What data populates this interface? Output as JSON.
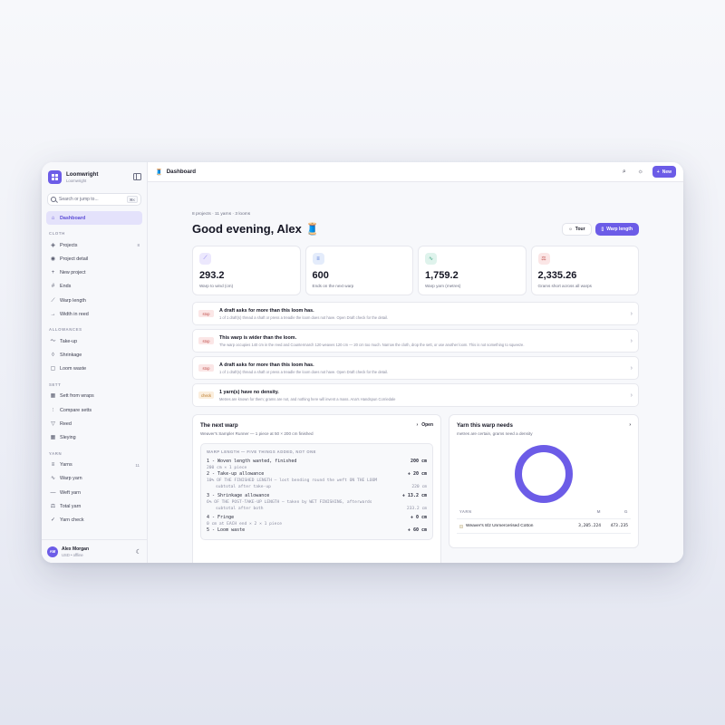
{
  "colors": {
    "accent": "#6c5ce7",
    "sidebar_bg": "#f7f8fb",
    "stop": "#c0504d",
    "check": "#b7731e"
  },
  "brand": {
    "name": "Loomwright",
    "sub": "Loomwright"
  },
  "search": {
    "placeholder": "Search or jump to...",
    "shortcut": "⌘K"
  },
  "nav": {
    "dashboard": "Dashboard",
    "sections": {
      "cloth": "CLOTH",
      "allowances": "ALLOWANCES",
      "sett": "SETT",
      "yarn": "YARN"
    },
    "cloth": [
      {
        "label": "Projects",
        "count": "8",
        "icon": "layers-icon"
      },
      {
        "label": "Project detail",
        "icon": "eye-icon"
      },
      {
        "label": "New project",
        "icon": "plus-icon"
      },
      {
        "label": "Ends",
        "icon": "hash-icon"
      },
      {
        "label": "Warp length",
        "icon": "ruler-icon"
      },
      {
        "label": "Width in reed",
        "icon": "arrow-right-icon"
      }
    ],
    "allowances": [
      {
        "label": "Take-up",
        "icon": "trend-icon"
      },
      {
        "label": "Shrinkage",
        "icon": "drop-icon"
      },
      {
        "label": "Loom waste",
        "icon": "trash-icon"
      }
    ],
    "sett": [
      {
        "label": "Sett from wraps",
        "icon": "grid-icon"
      },
      {
        "label": "Compare setts",
        "icon": "sliders-icon"
      },
      {
        "label": "Reed",
        "icon": "filter-icon"
      },
      {
        "label": "Sleying",
        "icon": "grid-icon"
      }
    ],
    "yarn": [
      {
        "label": "Yarns",
        "count": "11",
        "icon": "list-icon"
      },
      {
        "label": "Warp yarn",
        "icon": "pulse-icon"
      },
      {
        "label": "Weft yarn",
        "icon": "minus-icon"
      },
      {
        "label": "Total yarn",
        "icon": "scale-icon"
      },
      {
        "label": "Yarn check",
        "icon": "check-icon"
      }
    ]
  },
  "user": {
    "initials": "AM",
    "name": "Alex Morgan",
    "sub": "USD • offline"
  },
  "topbar": {
    "title": "Dashboard",
    "new_label": "New"
  },
  "meta": "8 projects · 11 yarns · 3 looms",
  "greeting": "Good evening, Alex 🧵",
  "buttons": {
    "tour": "Tour",
    "warp_length": "Warp length"
  },
  "stats": [
    {
      "value": "293.2",
      "label": "Warp to wind (cm)",
      "icon": "ruler-icon",
      "color": "#ece8fd",
      "fg": "#6c5ce7"
    },
    {
      "value": "600",
      "label": "Ends on the next warp",
      "icon": "list-icon",
      "color": "#e4ecfb",
      "fg": "#4a6fd6"
    },
    {
      "value": "1,759.2",
      "label": "Warp yarn (metres)",
      "icon": "pulse-icon",
      "color": "#dff3ec",
      "fg": "#2f9d76"
    },
    {
      "value": "2,335.26",
      "label": "Grams short across all warps",
      "icon": "scale-icon",
      "color": "#fbe6e6",
      "fg": "#c0504d"
    }
  ],
  "alerts": [
    {
      "badge": "stop",
      "title": "A draft asks for more than this loom has.",
      "desc": "1 of 1 draft(s) thread a shaft or press a treadle the loom does not have. Open Draft check for the detail."
    },
    {
      "badge": "stop",
      "title": "This warp is wider than the loom.",
      "desc": "The warp occupies 140 cm in the reed and Countermarch 120 weaves 120 cm — 20 cm too much. Narrow the cloth, drop the sett, or use another loom. This is not something to squeeze."
    },
    {
      "badge": "stop",
      "title": "A draft asks for more than this loom has.",
      "desc": "1 of 1 draft(s) thread a shaft or press a treadle the loom does not have. Open Draft check for the detail."
    },
    {
      "badge": "check",
      "title": "1 yarn(s) have no density.",
      "desc": "Metres are known for them; grams are not, and nothing here will invent a mass. Ana's Handspun Corriedale"
    }
  ],
  "next_warp": {
    "title": "The next warp",
    "sub": "Weaver's Sampler Runner — 1 piece at 50 × 200 cm finished",
    "open": "Open",
    "calc_head": "WARP LENGTH — FIVE THINGS ADDED, NOT ONE",
    "rows": [
      {
        "label": "1 - Woven length wanted, finished",
        "value": "200 cm",
        "notes": [
          "200 cm × 1 piece"
        ]
      },
      {
        "label": "2 - Take-up allowance",
        "value": "+ 20 cm",
        "notes": [
          "10% OF THE FINISHED LENGTH — lost bending round the weft ON THE LOOM"
        ],
        "sub": {
          "label": "subtotal after take-up",
          "value": "220 cm"
        }
      },
      {
        "label": "3 - Shrinkage allowance",
        "value": "+ 13.2 cm",
        "notes": [
          "6% OF THE POST-TAKE-UP LENGTH — taken by WET FINISHING, afterwards"
        ],
        "sub": {
          "label": "subtotal after both",
          "value": "233.2 cm"
        }
      },
      {
        "label": "4 - Fringe",
        "value": "+ 0 cm",
        "notes": [
          "0 cm at EACH end × 2 × 1 piece"
        ]
      },
      {
        "label": "5 - Loom waste",
        "value": "+ 60 cm",
        "notes": []
      }
    ]
  },
  "yarn_card": {
    "title": "Yarn this warp needs",
    "sub": "metres are certain, grams need a density",
    "headers": {
      "yarn": "YARN",
      "m": "M",
      "g": "G"
    },
    "rows": [
      {
        "name": "Weaver's 8/2 Unmercerised Cotton",
        "m": "3,205.224",
        "g": "473.235",
        "share": 1
      }
    ]
  }
}
